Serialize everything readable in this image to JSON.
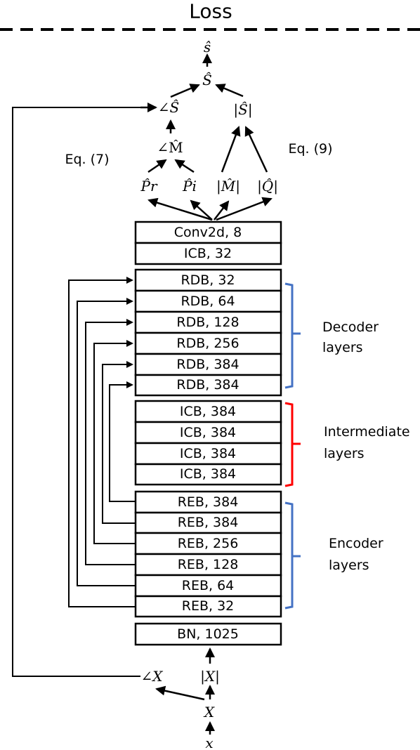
{
  "title": "Loss",
  "outputs": {
    "s_hat_time": "ŝ",
    "S_hat": "Ŝ",
    "angle_S_hat": "∠Ŝ",
    "mag_S_hat": "|Ŝ|",
    "angle_M_hat": "∠M̂",
    "P_r_hat": "P̂r",
    "P_i_hat": "P̂i",
    "mag_M_hat": "|M̂|",
    "mag_Q_hat": "|Q̂|"
  },
  "equations": {
    "eq7": "Eq. (7)",
    "eq9": "Eq. (9)"
  },
  "head_blocks": [
    "Conv2d, 8",
    "ICB, 32"
  ],
  "decoder_blocks": [
    "RDB, 32",
    "RDB, 64",
    "RDB, 128",
    "RDB, 256",
    "RDB, 384",
    "RDB, 384"
  ],
  "intermediate_blocks": [
    "ICB, 384",
    "ICB, 384",
    "ICB, 384",
    "ICB, 384"
  ],
  "encoder_blocks": [
    "REB, 384",
    "REB, 384",
    "REB, 256",
    "REB, 128",
    "REB, 64",
    "REB, 32"
  ],
  "bottleneck_block": "BN, 1025",
  "groups": {
    "decoder": {
      "line1": "Decoder",
      "line2": "layers",
      "color": "#4472c4"
    },
    "intermediate": {
      "line1": "Intermediate",
      "line2": "layers",
      "color": "#ff0000"
    },
    "encoder": {
      "line1": "Encoder",
      "line2": "layers",
      "color": "#4472c4"
    }
  },
  "inputs": {
    "angle_X": "∠X",
    "mag_X": "|X|",
    "X": "X",
    "x": "x"
  }
}
